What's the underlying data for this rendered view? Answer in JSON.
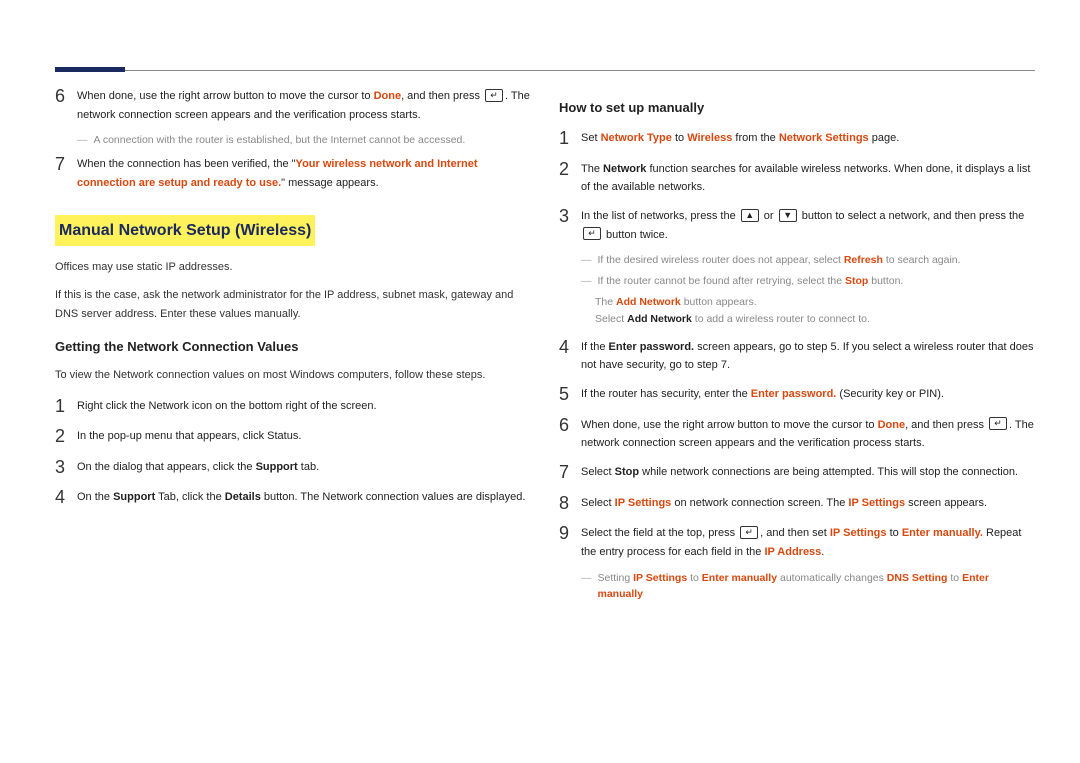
{
  "left": {
    "steps_top": [
      {
        "num": "6",
        "parts": [
          {
            "t": "When done, use the right arrow button to move the cursor to "
          },
          {
            "t": "Done",
            "cls": "strong-red"
          },
          {
            "t": ", and then press "
          },
          {
            "icon": "enter"
          },
          {
            "t": ". The network connection screen appears and the verification process starts."
          }
        ],
        "note": [
          {
            "t": "A connection with the router is established, but the Internet cannot be accessed."
          }
        ]
      },
      {
        "num": "7",
        "parts": [
          {
            "t": "When the connection has been verified, the \""
          },
          {
            "t": "Your wireless network and Internet connection are setup and ready to use.",
            "cls": "strong-red"
          },
          {
            "t": "\" message appears."
          }
        ]
      }
    ],
    "hl_title": "Manual Network Setup (Wireless)",
    "para1": "Offices may use static IP addresses.",
    "para2": "If this is the case, ask the network administrator for the IP address, subnet mask, gateway and DNS server address. Enter these values manually.",
    "sub_h": "Getting the Network Connection Values",
    "para3": "To view the Network connection values on most Windows computers, follow these steps.",
    "steps_bottom": [
      {
        "num": "1",
        "parts": [
          {
            "t": "Right click the Network icon on the bottom right of the screen."
          }
        ]
      },
      {
        "num": "2",
        "parts": [
          {
            "t": "In the pop-up menu that appears, click Status."
          }
        ]
      },
      {
        "num": "3",
        "parts": [
          {
            "t": "On the dialog that appears, click the "
          },
          {
            "t": "Support",
            "cls": "bold"
          },
          {
            "t": " tab."
          }
        ]
      },
      {
        "num": "4",
        "parts": [
          {
            "t": "On the "
          },
          {
            "t": "Support",
            "cls": "bold"
          },
          {
            "t": " Tab, click the "
          },
          {
            "t": "Details",
            "cls": "bold"
          },
          {
            "t": " button. The Network connection values are displayed."
          }
        ]
      }
    ]
  },
  "right": {
    "sub_h": "How to set up manually",
    "steps": [
      {
        "num": "1",
        "parts": [
          {
            "t": "Set "
          },
          {
            "t": "Network Type",
            "cls": "strong-red"
          },
          {
            "t": " to "
          },
          {
            "t": "Wireless",
            "cls": "strong-red"
          },
          {
            "t": " from the "
          },
          {
            "t": "Network Settings",
            "cls": "strong-red"
          },
          {
            "t": " page."
          }
        ]
      },
      {
        "num": "2",
        "parts": [
          {
            "t": "The "
          },
          {
            "t": "Network",
            "cls": "bold"
          },
          {
            "t": " function searches for available wireless networks. When done, it displays a list of the available networks."
          }
        ]
      },
      {
        "num": "3",
        "parts": [
          {
            "t": "In the list of networks, press the "
          },
          {
            "icon": "up"
          },
          {
            "t": " or "
          },
          {
            "icon": "down"
          },
          {
            "t": " button to select a network, and then press the "
          },
          {
            "icon": "enter"
          },
          {
            "t": " button twice."
          }
        ],
        "notes": [
          {
            "line": [
              {
                "t": "If the desired wireless router does not appear, select "
              },
              {
                "t": "Refresh",
                "cls": "strong-red"
              },
              {
                "t": " to search again."
              }
            ]
          },
          {
            "line": [
              {
                "t": "If the router cannot be found after retrying, select the "
              },
              {
                "t": "Stop",
                "cls": "strong-red"
              },
              {
                "t": " button."
              }
            ],
            "subs": [
              [
                {
                  "t": "The "
                },
                {
                  "t": "Add Network",
                  "cls": "strong-red"
                },
                {
                  "t": " button appears."
                }
              ],
              [
                {
                  "t": "Select "
                },
                {
                  "t": "Add Network",
                  "cls": "bold"
                },
                {
                  "t": " to add a wireless router to connect to."
                }
              ]
            ]
          }
        ]
      },
      {
        "num": "4",
        "parts": [
          {
            "t": "If the "
          },
          {
            "t": "Enter password.",
            "cls": "bold"
          },
          {
            "t": " screen appears, go to step 5. If you select a wireless router that does not have security, go to step 7."
          }
        ]
      },
      {
        "num": "5",
        "parts": [
          {
            "t": "If the router has security, enter the "
          },
          {
            "t": "Enter password.",
            "cls": "strong-red"
          },
          {
            "t": " (Security key or PIN)."
          }
        ]
      },
      {
        "num": "6",
        "parts": [
          {
            "t": "When done, use the right arrow button to move the cursor to "
          },
          {
            "t": "Done",
            "cls": "strong-red"
          },
          {
            "t": ", and then press "
          },
          {
            "icon": "enter"
          },
          {
            "t": ". The network connection screen appears and the verification process starts."
          }
        ]
      },
      {
        "num": "7",
        "parts": [
          {
            "t": "Select "
          },
          {
            "t": "Stop",
            "cls": "bold"
          },
          {
            "t": " while network connections are being attempted. This will stop the connection."
          }
        ]
      },
      {
        "num": "8",
        "parts": [
          {
            "t": "Select "
          },
          {
            "t": "IP Settings",
            "cls": "strong-red"
          },
          {
            "t": " on network connection screen. The "
          },
          {
            "t": "IP Settings",
            "cls": "strong-red"
          },
          {
            "t": " screen appears."
          }
        ]
      },
      {
        "num": "9",
        "parts": [
          {
            "t": "Select the field at the top, press "
          },
          {
            "icon": "enter"
          },
          {
            "t": ", and then set "
          },
          {
            "t": "IP Settings",
            "cls": "strong-red"
          },
          {
            "t": " to "
          },
          {
            "t": "Enter manually.",
            "cls": "strong-red"
          },
          {
            "t": " Repeat the entry process for each field in the "
          },
          {
            "t": "IP Address",
            "cls": "strong-red"
          },
          {
            "t": "."
          }
        ],
        "notes": [
          {
            "line": [
              {
                "t": "Setting "
              },
              {
                "t": "IP Settings",
                "cls": "strong-red"
              },
              {
                "t": " to "
              },
              {
                "t": "Enter manually",
                "cls": "strong-red"
              },
              {
                "t": " automatically changes "
              },
              {
                "t": "DNS Setting",
                "cls": "strong-red"
              },
              {
                "t": " to "
              },
              {
                "t": "Enter manually",
                "cls": "strong-red"
              }
            ]
          }
        ]
      }
    ]
  }
}
